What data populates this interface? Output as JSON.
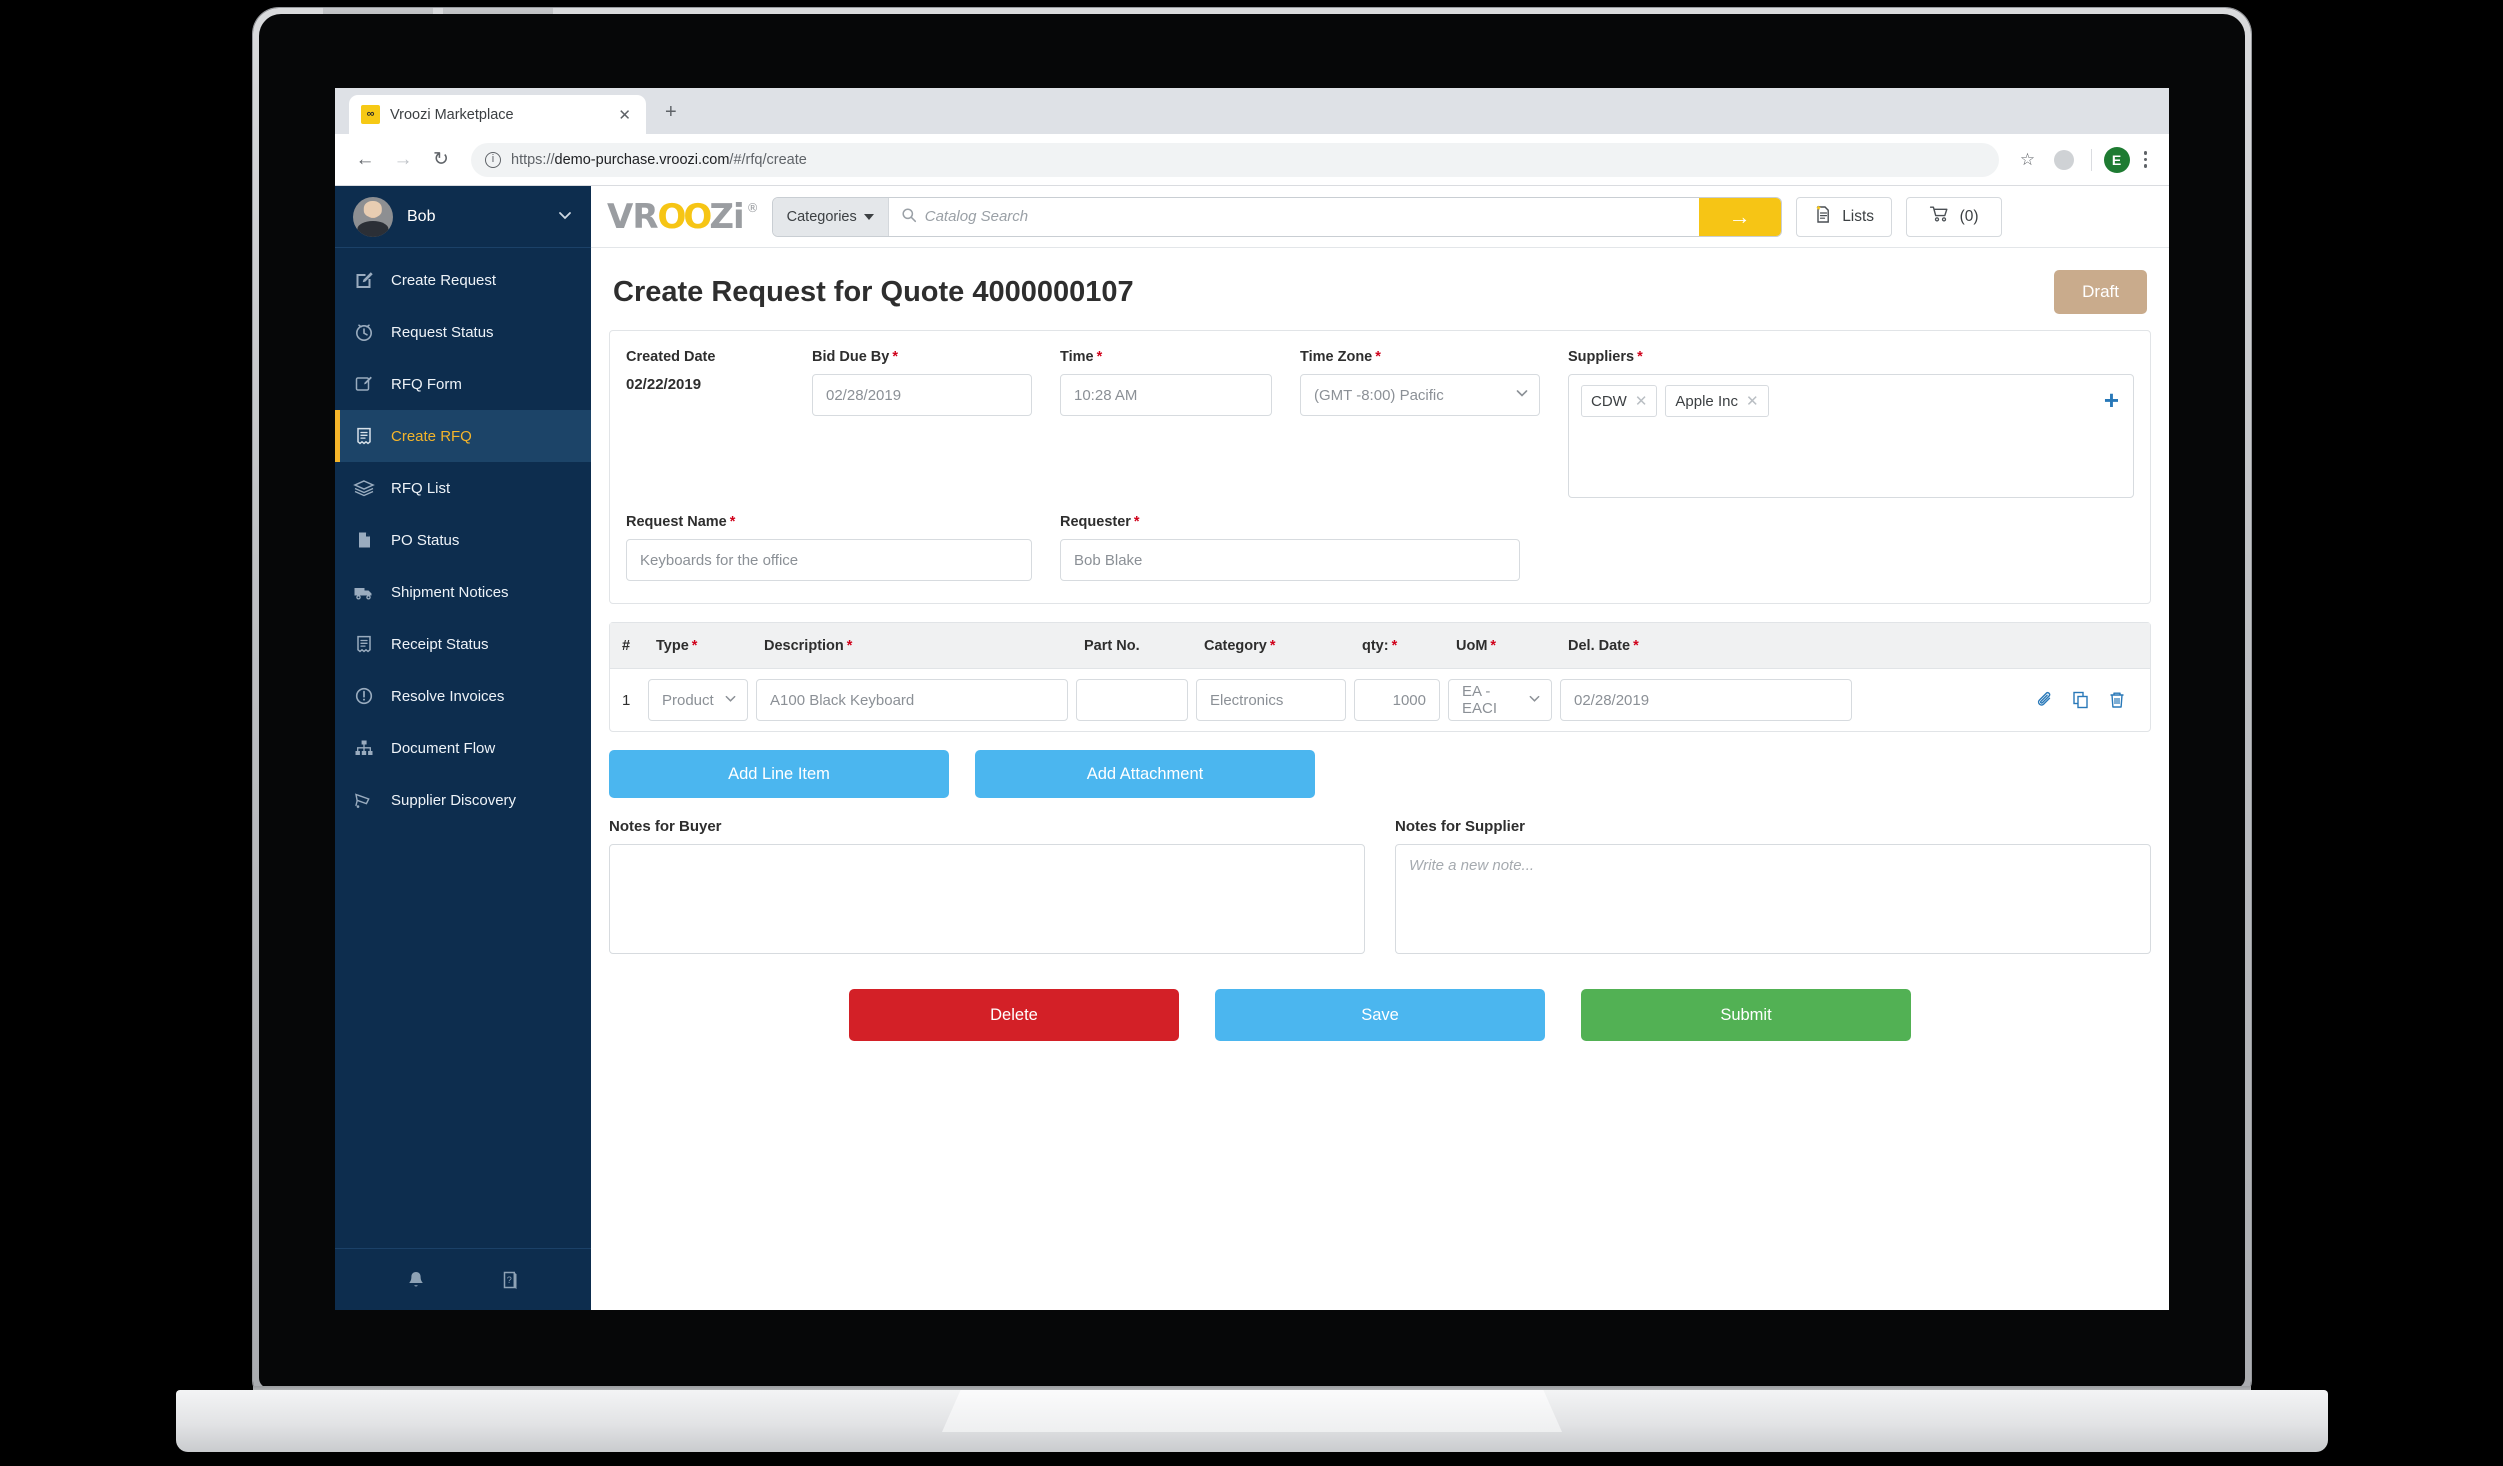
{
  "browser": {
    "tab": {
      "title": "Vroozi Marketplace",
      "favicon": "vroozi-favicon",
      "close": "✕"
    },
    "new_tab": "+",
    "nav": {
      "back": "←",
      "forward": "→",
      "reload": "↻"
    },
    "url": {
      "scheme": "https://",
      "host": "demo-purchase.vroozi.com",
      "path": "/#/rfq/create"
    },
    "profile_initial": "E"
  },
  "sidebar": {
    "user": {
      "name": "Bob",
      "chevron": "⌄"
    },
    "items": [
      {
        "label": "Create Request",
        "icon": "create-request-icon",
        "active": false
      },
      {
        "label": "Request Status",
        "icon": "clock-icon",
        "active": false
      },
      {
        "label": "RFQ Form",
        "icon": "form-edit-icon",
        "active": false
      },
      {
        "label": "Create RFQ",
        "icon": "receipt-icon",
        "active": true
      },
      {
        "label": "RFQ List",
        "icon": "stack-icon",
        "active": false
      },
      {
        "label": "PO Status",
        "icon": "document-icon",
        "active": false
      },
      {
        "label": "Shipment Notices",
        "icon": "truck-icon",
        "active": false
      },
      {
        "label": "Receipt Status",
        "icon": "receipt-icon",
        "active": false
      },
      {
        "label": "Resolve Invoices",
        "icon": "alert-circle-icon",
        "active": false
      },
      {
        "label": "Document Flow",
        "icon": "sitemap-icon",
        "active": false
      },
      {
        "label": "Supplier Discovery",
        "icon": "cart-discovery-icon",
        "active": false
      }
    ],
    "footer": [
      {
        "icon": "bell-icon"
      },
      {
        "icon": "help-book-icon"
      }
    ]
  },
  "appbar": {
    "logo": {
      "pre": "VR",
      "oo": "OO",
      "post": "Zi",
      "reg": "®"
    },
    "categories_label": "Categories",
    "search_placeholder": "Catalog Search",
    "search_value": "",
    "go_label": "→",
    "lists_label": "Lists",
    "cart_label": "(0)"
  },
  "page": {
    "title": "Create Request for Quote 4000000107",
    "status_badge": "Draft"
  },
  "form": {
    "created_date": {
      "label": "Created Date",
      "value": "02/22/2019"
    },
    "bid_due_by": {
      "label": "Bid Due By",
      "required": "*",
      "value": "02/28/2019"
    },
    "time": {
      "label": "Time",
      "required": "*",
      "value": "10:28 AM"
    },
    "time_zone": {
      "label": "Time Zone",
      "required": "*",
      "value": "(GMT -8:00) Pacific"
    },
    "suppliers": {
      "label": "Suppliers",
      "required": "*",
      "chips": [
        "CDW",
        "Apple Inc"
      ],
      "add": "+"
    },
    "request_name": {
      "label": "Request Name",
      "required": "*",
      "value": "Keyboards for the office"
    },
    "requester": {
      "label": "Requester",
      "required": "*",
      "value": "Bob Blake"
    }
  },
  "items": {
    "columns": [
      "#",
      "Type",
      "Description",
      "Part No.",
      "Category",
      "qty:",
      "UoM",
      "Del. Date"
    ],
    "required_flags": [
      false,
      true,
      true,
      false,
      true,
      true,
      true,
      true
    ],
    "rows": [
      {
        "num": "1",
        "type": "Product",
        "description": "A100 Black Keyboard",
        "part_no": "",
        "category": "Electronics",
        "qty": "1000",
        "uom": "EA - EACI",
        "del_date": "02/28/2019",
        "actions": [
          "paperclip-icon",
          "copy-icon",
          "trash-icon"
        ]
      }
    ],
    "add_line_item": "Add Line Item",
    "add_attachment": "Add Attachment"
  },
  "notes": {
    "buyer": {
      "label": "Notes for Buyer",
      "value": "",
      "placeholder": ""
    },
    "supplier": {
      "label": "Notes for Supplier",
      "value": "",
      "placeholder": "Write a new note..."
    }
  },
  "actions": {
    "delete": "Delete",
    "save": "Save",
    "submit": "Submit"
  },
  "colors": {
    "sidebar": "#0d2d4e",
    "accent_yellow": "#f6c515",
    "active_nav": "#f5b52a",
    "draft_badge": "#c9ab8c",
    "blue_button": "#4bb6ef",
    "red_button": "#d32027",
    "green_button": "#52b154",
    "required_star": "#d0021b"
  }
}
